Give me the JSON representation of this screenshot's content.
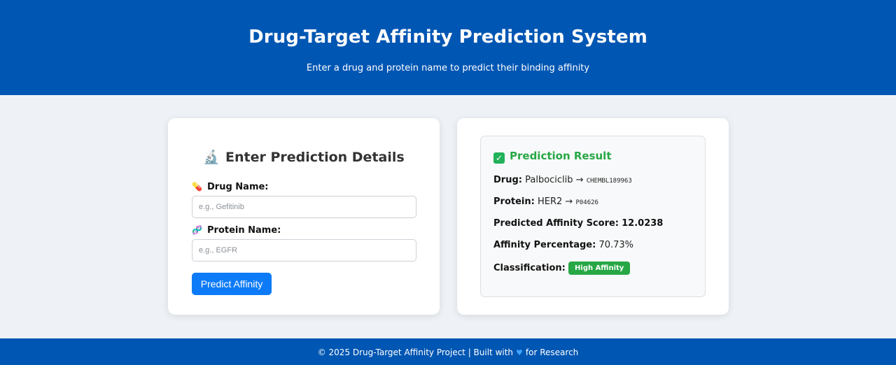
{
  "header": {
    "title": "Drug-Target Affinity Prediction System",
    "subtitle": "Enter a drug and protein name to predict their binding affinity"
  },
  "form": {
    "title": "Enter Prediction Details",
    "title_icon": "microscope-icon",
    "drug_label": "Drug Name:",
    "drug_icon": "pill-icon",
    "drug_placeholder": "e.g., Gefitinib",
    "drug_value": "",
    "protein_label": "Protein Name:",
    "protein_icon": "dna-icon",
    "protein_placeholder": "e.g., EGFR",
    "protein_value": "",
    "submit_label": "Predict Affinity"
  },
  "result": {
    "title": "Prediction Result",
    "title_icon": "check-icon",
    "drug_label": "Drug:",
    "drug_name": "Palbociclib",
    "drug_id": "CHEMBL189963",
    "protein_label": "Protein:",
    "protein_name": "HER2",
    "protein_id": "P04626",
    "arrow": "→",
    "score_label": "Predicted Affinity Score:",
    "score_value": "12.0238",
    "percent_label": "Affinity Percentage:",
    "percent_value": "70.73%",
    "class_label": "Classification:",
    "class_value": "High Affinity"
  },
  "footer": {
    "text_before": "© 2025 Drug-Target Affinity Project | Built with",
    "icon": "heart-icon",
    "text_after": "for Research"
  },
  "colors": {
    "header_bg": "#0056b3",
    "button_bg": "#0d7bf7",
    "success": "#28a745"
  }
}
